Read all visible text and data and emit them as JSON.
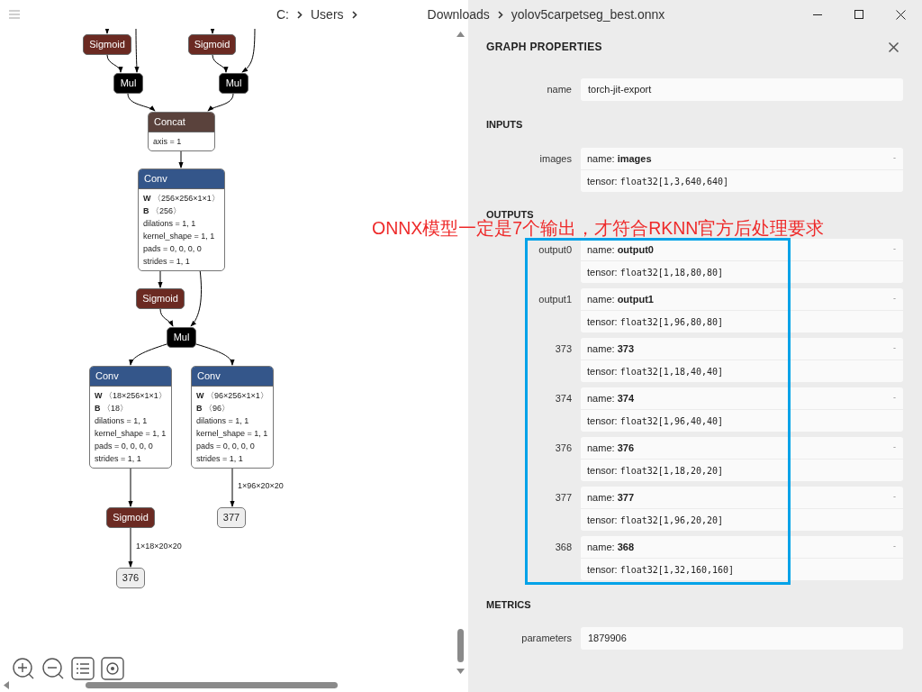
{
  "window": {
    "breadcrumb": [
      "C:",
      "Users",
      "Downloads",
      "yolov5carpetseg_best.onnx"
    ]
  },
  "graph": {
    "nodes": [
      {
        "kind": "sigmoid",
        "label": "Sigmoid"
      },
      {
        "kind": "sigmoid",
        "label": "Sigmoid"
      },
      {
        "kind": "mul",
        "label": "Mul"
      },
      {
        "kind": "mul",
        "label": "Mul"
      },
      {
        "kind": "concat",
        "label": "Concat",
        "attributes": [
          "axis = 1"
        ]
      },
      {
        "kind": "conv",
        "label": "Conv",
        "attributes": [
          "**W** 〈256×256×1×1〉",
          "**B** 〈256〉",
          "dilations = 1, 1",
          "kernel_shape = 1, 1",
          "pads = 0, 0, 0, 0",
          "strides = 1, 1"
        ]
      },
      {
        "kind": "sigmoid",
        "label": "Sigmoid"
      },
      {
        "kind": "mul",
        "label": "Mul"
      },
      {
        "kind": "conv",
        "label": "Conv",
        "attributes": [
          "**W** 〈18×256×1×1〉",
          "**B** 〈18〉",
          "dilations = 1, 1",
          "kernel_shape = 1, 1",
          "pads = 0, 0, 0, 0",
          "strides = 1, 1"
        ]
      },
      {
        "kind": "conv",
        "label": "Conv",
        "attributes": [
          "**W** 〈96×256×1×1〉",
          "**B** 〈96〉",
          "dilations = 1, 1",
          "kernel_shape = 1, 1",
          "pads = 0, 0, 0, 0",
          "strides = 1, 1"
        ]
      },
      {
        "kind": "sigmoid",
        "label": "Sigmoid"
      },
      {
        "kind": "output",
        "label": "377"
      },
      {
        "kind": "output",
        "label": "376"
      }
    ],
    "edge_labels": [
      "1×96×20×20",
      "1×18×20×20"
    ]
  },
  "properties": {
    "title": "GRAPH PROPERTIES",
    "name": {
      "label": "name",
      "value": "torch-jit-export"
    },
    "inputs": {
      "title": "INPUTS",
      "items": [
        {
          "label": "images",
          "expander": "-",
          "lines": [
            {
              "kind": "name",
              "key": "name:",
              "value": "images"
            },
            {
              "kind": "tensor",
              "key": "tensor:",
              "value": "float32[1,3,640,640]"
            }
          ]
        }
      ]
    },
    "outputs": {
      "title": "OUTPUTS",
      "items": [
        {
          "label": "output0",
          "expander": "-",
          "lines": [
            {
              "kind": "name",
              "key": "name:",
              "value": "output0"
            },
            {
              "kind": "tensor",
              "key": "tensor:",
              "value": "float32[1,18,80,80]"
            }
          ]
        },
        {
          "label": "output1",
          "expander": "-",
          "lines": [
            {
              "kind": "name",
              "key": "name:",
              "value": "output1"
            },
            {
              "kind": "tensor",
              "key": "tensor:",
              "value": "float32[1,96,80,80]"
            }
          ]
        },
        {
          "label": "373",
          "expander": "-",
          "lines": [
            {
              "kind": "name",
              "key": "name:",
              "value": "373"
            },
            {
              "kind": "tensor",
              "key": "tensor:",
              "value": "float32[1,18,40,40]"
            }
          ]
        },
        {
          "label": "374",
          "expander": "-",
          "lines": [
            {
              "kind": "name",
              "key": "name:",
              "value": "374"
            },
            {
              "kind": "tensor",
              "key": "tensor:",
              "value": "float32[1,96,40,40]"
            }
          ]
        },
        {
          "label": "376",
          "expander": "-",
          "lines": [
            {
              "kind": "name",
              "key": "name:",
              "value": "376"
            },
            {
              "kind": "tensor",
              "key": "tensor:",
              "value": "float32[1,18,20,20]"
            }
          ]
        },
        {
          "label": "377",
          "expander": "-",
          "lines": [
            {
              "kind": "name",
              "key": "name:",
              "value": "377"
            },
            {
              "kind": "tensor",
              "key": "tensor:",
              "value": "float32[1,96,20,20]"
            }
          ]
        },
        {
          "label": "368",
          "expander": "-",
          "lines": [
            {
              "kind": "name",
              "key": "name:",
              "value": "368"
            },
            {
              "kind": "tensor",
              "key": "tensor:",
              "value": "float32[1,32,160,160]"
            }
          ]
        }
      ]
    },
    "metrics": {
      "title": "METRICS",
      "rows": [
        {
          "label": "parameters",
          "value": "1879906"
        }
      ]
    }
  },
  "annotation": {
    "text": "ONNX模型一定是7个输出，才符合RKNN官方后处理要求"
  }
}
